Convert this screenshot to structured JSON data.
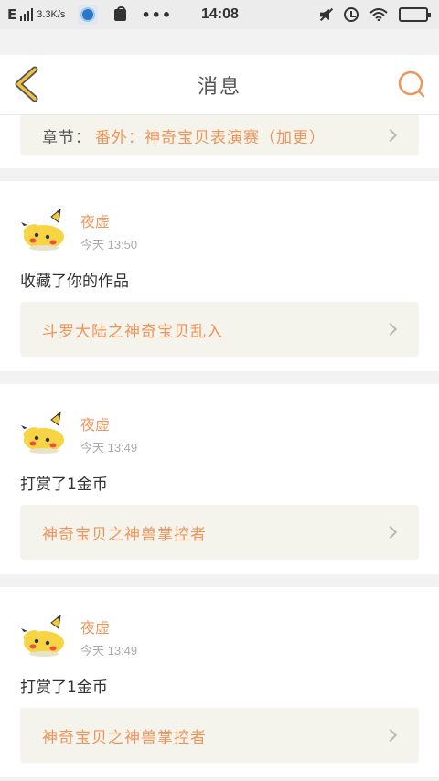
{
  "status_bar": {
    "signal_label": "E",
    "net_speed": "3.3K/s",
    "more": "•••",
    "time": "14:08"
  },
  "nav": {
    "title": "消息"
  },
  "partial_card": {
    "prefix": "章节：",
    "title": "番外：神奇宝贝表演赛（加更）"
  },
  "messages": [
    {
      "user": "夜虚",
      "time": "今天 13:50",
      "action": "收藏了你的作品",
      "work": "斗罗大陆之神奇宝贝乱入"
    },
    {
      "user": "夜虚",
      "time": "今天 13:49",
      "action": "打赏了1金币",
      "work": "神奇宝贝之神兽掌控者"
    },
    {
      "user": "夜虚",
      "time": "今天 13:49",
      "action": "打赏了1金币",
      "work": "神奇宝贝之神兽掌控者"
    }
  ],
  "colors": {
    "accent": "#f0955a",
    "link_bg": "#f4f3ec",
    "back_arrow": "#f0c040"
  }
}
